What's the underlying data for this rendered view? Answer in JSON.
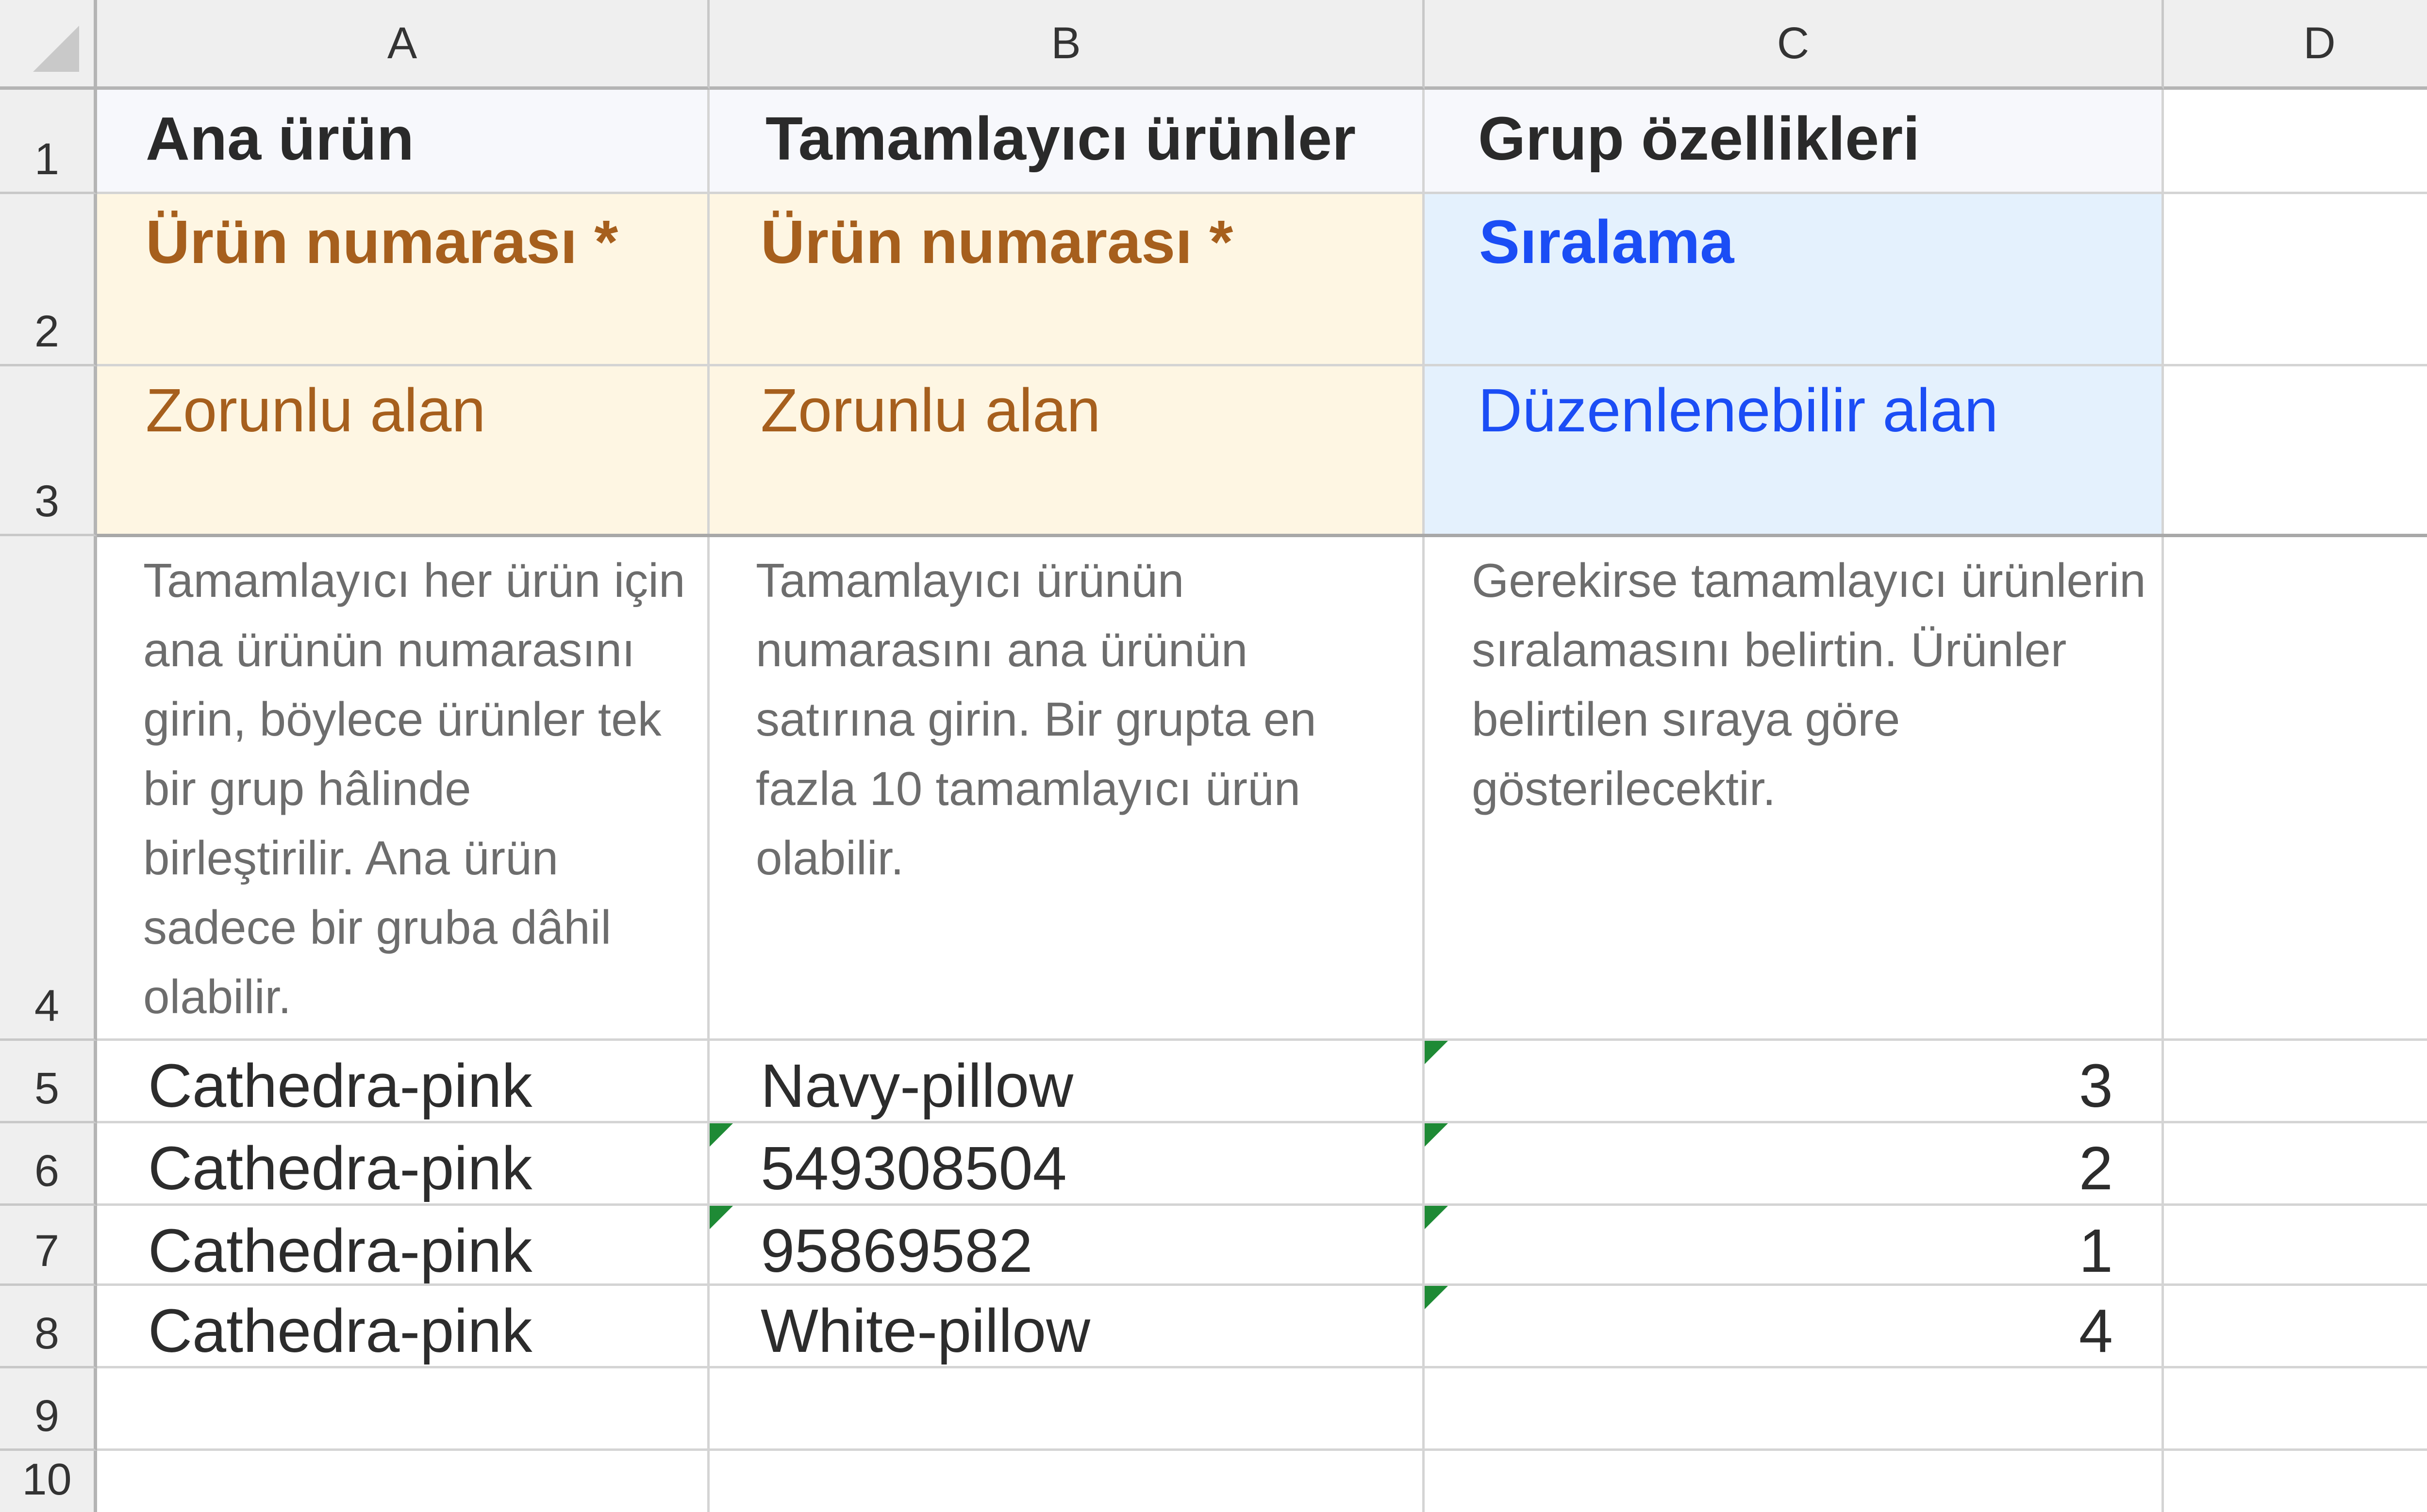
{
  "column_headers": [
    "A",
    "B",
    "C",
    "D"
  ],
  "row_headers": [
    "1",
    "2",
    "3",
    "4",
    "5",
    "6",
    "7",
    "8",
    "9",
    "10"
  ],
  "header_row": {
    "a": "Ana ürün",
    "b": "Tamamlayıcı ürünler",
    "c": "Grup özellikleri"
  },
  "field_row": {
    "a": "Ürün numarası *",
    "b": "Ürün numarası *",
    "c": "Sıralama"
  },
  "type_row": {
    "a": "Zorunlu alan",
    "b": "Zorunlu alan",
    "c": "Düzenlenebilir alan"
  },
  "description_row": {
    "a": "Tamamlayıcı her ürün için ana ürünün numarasını girin, böylece ürünler tek bir grup hâlinde birleştirilir. Ana ürün sadece bir gruba dâhil olabilir.",
    "b": "Tamamlayıcı ürünün numarasını ana ürünün satırına girin. Bir grupta en fazla 10 tamamlayıcı ürün olabilir.",
    "c": "Gerekirse tamamlayıcı ürünlerin sıralamasını belirtin. Ürünler belirtilen sıraya göre gösterilecektir."
  },
  "data_rows": [
    {
      "a": "Cathedra-pink",
      "b": "Navy-pillow",
      "c": "3"
    },
    {
      "a": "Cathedra-pink",
      "b": "549308504",
      "c": "2"
    },
    {
      "a": "Cathedra-pink",
      "b": "95869582",
      "c": "1"
    },
    {
      "a": "Cathedra-pink",
      "b": "White-pillow",
      "c": "4"
    }
  ],
  "colors": {
    "required_fill": "#fef6e3",
    "required_text": "#a65f1d",
    "editable_fill": "#e4f1fd",
    "editable_text": "#1b4df5",
    "error_flag": "#1e8a35"
  }
}
